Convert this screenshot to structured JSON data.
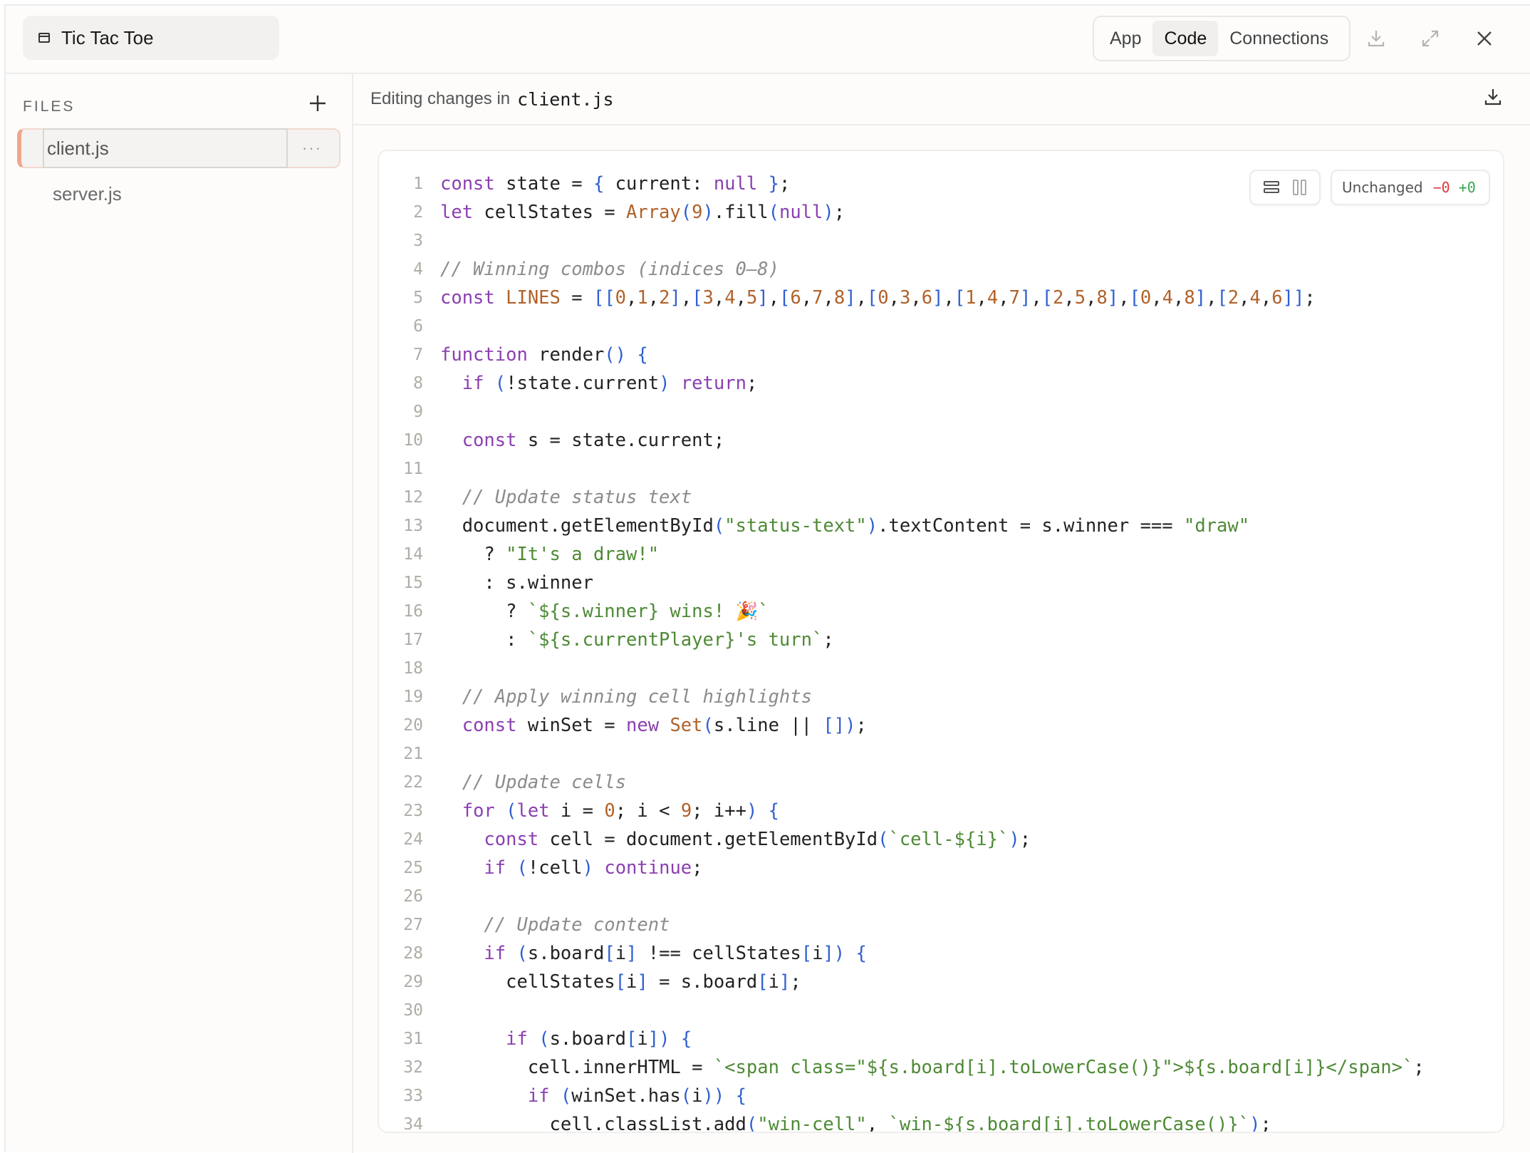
{
  "header": {
    "title": "Tic Tac Toe",
    "tabs": [
      {
        "label": "App",
        "active": false
      },
      {
        "label": "Code",
        "active": true
      },
      {
        "label": "Connections",
        "active": false
      }
    ]
  },
  "sidebar": {
    "files_label": "FILES",
    "files": [
      {
        "name": "client.js",
        "active": true
      },
      {
        "name": "server.js",
        "active": false
      }
    ],
    "more_label": "···"
  },
  "editor": {
    "editing_label": "Editing changes in",
    "filename": "client.js",
    "diff": {
      "status": "Unchanged",
      "removed": "−0",
      "added": "+0"
    },
    "lines": [
      "const state = { current: null };",
      "let cellStates = Array(9).fill(null);",
      "",
      "// Winning combos (indices 0–8)",
      "const LINES = [[0,1,2],[3,4,5],[6,7,8],[0,3,6],[1,4,7],[2,5,8],[0,4,8],[2,4,6]];",
      "",
      "function render() {",
      "  if (!state.current) return;",
      "",
      "  const s = state.current;",
      "",
      "  // Update status text",
      "  document.getElementById(\"status-text\").textContent = s.winner === \"draw\"",
      "    ? \"It's a draw!\"",
      "    : s.winner",
      "      ? `${s.winner} wins! 🎉`",
      "      : `${s.currentPlayer}'s turn`;",
      "",
      "  // Apply winning cell highlights",
      "  const winSet = new Set(s.line || []);",
      "",
      "  // Update cells",
      "  for (let i = 0; i < 9; i++) {",
      "    const cell = document.getElementById(`cell-${i}`);",
      "    if (!cell) continue;",
      "",
      "    // Update content",
      "    if (s.board[i] !== cellStates[i]) {",
      "      cellStates[i] = s.board[i];",
      "",
      "      if (s.board[i]) {",
      "        cell.innerHTML = `<span class=\"${s.board[i].toLowerCase()}\">${s.board[i]}</span>`;",
      "        if (winSet.has(i)) {",
      "          cell.classList.add(\"win-cell\", `win-${s.board[i].toLowerCase()}`);"
    ]
  },
  "icons": {
    "window": "window-icon",
    "download": "download-icon",
    "expand": "expand-icon",
    "close": "close-icon",
    "add": "plus-icon",
    "stacked_view": "stacked-view-icon",
    "split_view": "split-view-icon"
  }
}
